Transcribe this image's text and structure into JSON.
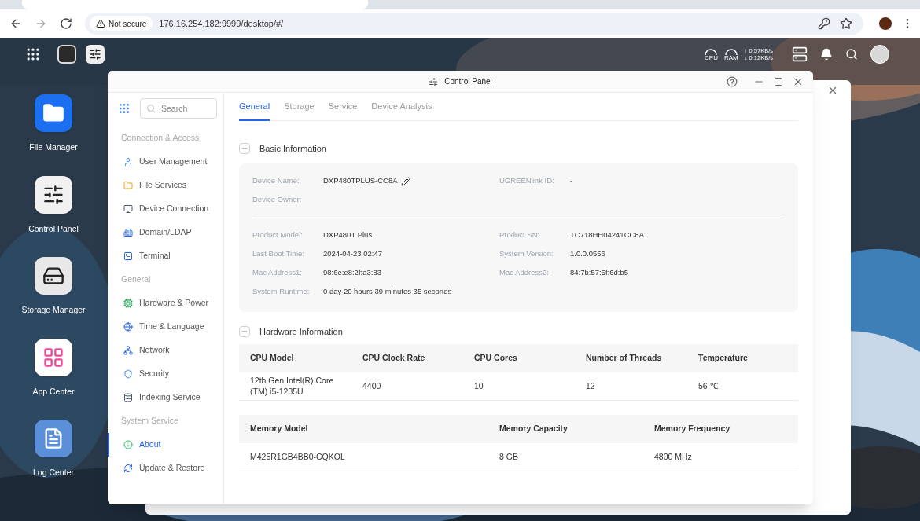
{
  "browser": {
    "security_label": "Not secure",
    "url": "176.16.254.182:9999/desktop/#/"
  },
  "topbar": {
    "cpu_label": "CPU",
    "ram_label": "RAM",
    "net_up": "↑ 0.57KB/s",
    "net_down": "↓ 0.12KB/s"
  },
  "desktop_icons": [
    {
      "label": "File Manager",
      "kind": "folder"
    },
    {
      "label": "Control Panel",
      "kind": "sliders"
    },
    {
      "label": "Storage Manager",
      "kind": "storage"
    },
    {
      "label": "App Center",
      "kind": "apps"
    },
    {
      "label": "Log Center",
      "kind": "log"
    }
  ],
  "window": {
    "title": "Control Panel"
  },
  "sidebar": {
    "search_placeholder": "Search",
    "groups": [
      {
        "heading": "Connection & Access",
        "items": [
          {
            "label": "User Management",
            "kind": "user",
            "selected": false
          },
          {
            "label": "File Services",
            "kind": "folder",
            "selected": false
          },
          {
            "label": "Device Connection",
            "kind": "device",
            "selected": false
          },
          {
            "label": "Domain/LDAP",
            "kind": "domain",
            "selected": false
          },
          {
            "label": "Terminal",
            "kind": "terminal",
            "selected": false
          }
        ]
      },
      {
        "heading": "General",
        "items": [
          {
            "label": "Hardware & Power",
            "kind": "hardware",
            "selected": false
          },
          {
            "label": "Time & Language",
            "kind": "globe",
            "selected": false
          },
          {
            "label": "Network",
            "kind": "network",
            "selected": false
          },
          {
            "label": "Security",
            "kind": "shield",
            "selected": false
          },
          {
            "label": "Indexing Service",
            "kind": "index",
            "selected": false
          }
        ]
      },
      {
        "heading": "System Service",
        "items": [
          {
            "label": "About",
            "kind": "info",
            "selected": true
          },
          {
            "label": "Update & Restore",
            "kind": "update",
            "selected": false
          }
        ]
      }
    ]
  },
  "tabs": [
    {
      "label": "General",
      "selected": true
    },
    {
      "label": "Storage",
      "selected": false
    },
    {
      "label": "Service",
      "selected": false
    },
    {
      "label": "Device Analysis",
      "selected": false
    }
  ],
  "basic_information": {
    "title": "Basic Information",
    "expanded": true,
    "blocks": [
      {
        "left": [
          {
            "label": "Device Name:",
            "value": "DXP480TPLUS-CC8A",
            "editable": true
          },
          {
            "label": "Device Owner:",
            "editable": false
          }
        ],
        "right": [
          {
            "label": "UGREENlink ID:",
            "value": "-",
            "editable": false
          }
        ]
      },
      {
        "left": [
          {
            "label": "Product Model:",
            "value": "DXP480T Plus",
            "editable": false
          },
          {
            "label": "Last Boot Time:",
            "value": "2024-04-23 02:47",
            "editable": false
          },
          {
            "label": "Mac Address1:",
            "value": "98:6e:e8:2f:a3:83",
            "editable": false
          },
          {
            "label": "System Runtime:",
            "value": "0 day 20 hours 39 minutes 35 seconds",
            "editable": false
          }
        ],
        "right": [
          {
            "label": "Product SN:",
            "value": "TC718HH04241CC8A",
            "editable": false
          },
          {
            "label": "System Version:",
            "value": "1.0.0.0556",
            "editable": false
          },
          {
            "label": "Mac Address2:",
            "value": "84:7b:57:5f:6d:b5",
            "editable": false
          }
        ]
      }
    ]
  },
  "hardware_information": {
    "title": "Hardware Information",
    "expanded": true,
    "cpu_table": {
      "columns": [
        "CPU Model",
        "CPU Clock Rate",
        "CPU Cores",
        "Number of Threads",
        "Temperature"
      ],
      "rows": [
        [
          "12th Gen Intel(R) Core (TM) i5-1235U",
          "4400",
          "10",
          "12",
          "56 ℃"
        ]
      ]
    },
    "memory_table": {
      "columns": [
        "Memory Model",
        "Memory Capacity",
        "Memory Frequency"
      ],
      "rows": [
        [
          "M425R1GB4BB0-CQKOL",
          "8 GB",
          "4800 MHz"
        ]
      ]
    }
  }
}
